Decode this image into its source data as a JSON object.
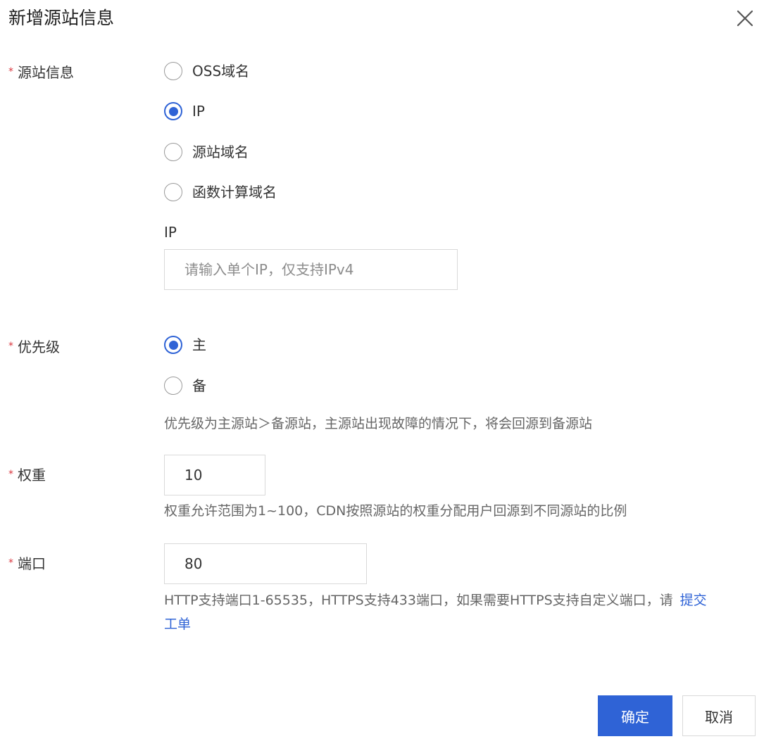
{
  "dialog": {
    "title": "新增源站信息"
  },
  "origin": {
    "label": "源站信息",
    "options": [
      "OSS域名",
      "IP",
      "源站域名",
      "函数计算域名"
    ],
    "selected": "IP",
    "ip_label": "IP",
    "ip_value": "",
    "ip_placeholder": "请输入单个IP，仅支持IPv4"
  },
  "priority": {
    "label": "优先级",
    "options": [
      "主",
      "备"
    ],
    "selected": "主",
    "help": "优先级为主源站＞备源站，主源站出现故障的情况下，将会回源到备源站"
  },
  "weight": {
    "label": "权重",
    "value": "10",
    "help": "权重允许范围为1~100，CDN按照源站的权重分配用户回源到不同源站的比例"
  },
  "port": {
    "label": "端口",
    "value": "80",
    "help": "HTTP支持端口1-65535，HTTPS支持433端口，如果需要HTTPS支持自定义端口，请",
    "link": "提交工单"
  },
  "buttons": {
    "confirm": "确定",
    "cancel": "取消"
  },
  "required_mark": "*",
  "colors": {
    "primary": "#2f63d6",
    "required": "#d9363e",
    "help_text": "#666666"
  }
}
